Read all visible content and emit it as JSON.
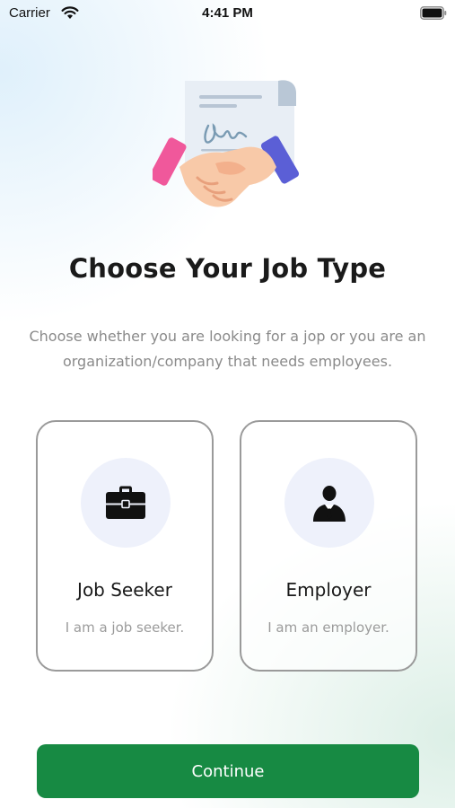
{
  "status_bar": {
    "carrier": "Carrier",
    "time": "4:41 PM",
    "icons": [
      "wifi-icon",
      "battery-icon"
    ]
  },
  "header": {
    "illustration": "handshake-contract-illustration",
    "title": "Choose Your Job Type",
    "subtitle": "Choose whether you are looking for a jop or you are an organization/company that needs employees."
  },
  "options": [
    {
      "icon": "briefcase-icon",
      "title": "Job Seeker",
      "description": "I am a job seeker."
    },
    {
      "icon": "businessman-icon",
      "title": "Employer",
      "description": "I am an employer."
    }
  ],
  "continue_button": {
    "label": "Continue"
  },
  "colors": {
    "primary_green": "#178a43",
    "card_border": "#9a9a9a",
    "icon_circle_bg": "#eef1fb",
    "muted_text": "#8a8a8a"
  }
}
